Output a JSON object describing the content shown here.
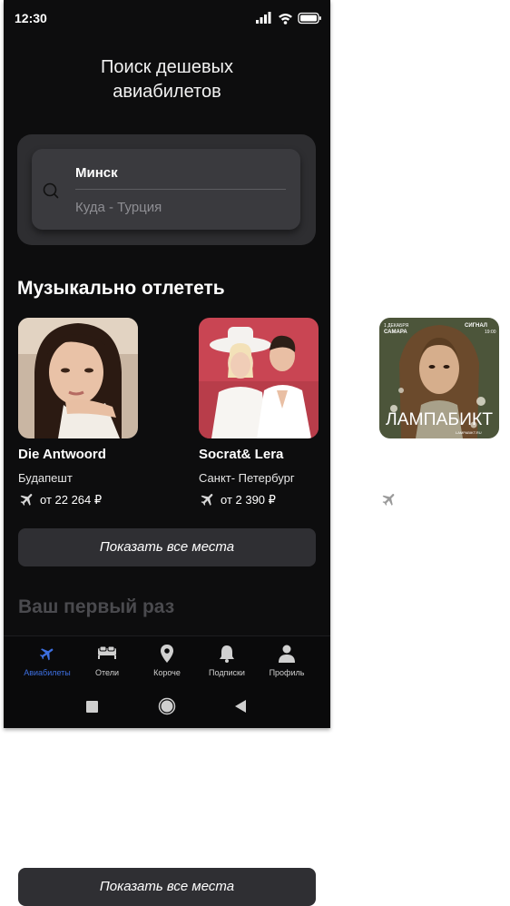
{
  "status_bar": {
    "time": "12:30"
  },
  "header": {
    "title": "Поиск дешевых\nавиабилетов"
  },
  "search": {
    "from": "Минск",
    "to_placeholder": "Куда - Турция"
  },
  "music_section": {
    "title": "Музыкально отлететь",
    "cards": [
      {
        "name": "Die Antwoord",
        "city": "Будапешт",
        "price": "от 22 264 ₽"
      },
      {
        "name": "Socrat& Lera",
        "city": "Санкт- Петербург",
        "price": "от 2 390 ₽"
      }
    ],
    "poster": {
      "date": "1 ДЕКАБРЯ",
      "city": "САМАРА",
      "venue": "СИГНАЛ",
      "time": "19:00",
      "title": "ЛАМПАБИКТ",
      "site": "LAMPABIKT.RU"
    }
  },
  "show_all_label": "Показать все места",
  "first_time_section": {
    "title": "Ваш первый раз"
  },
  "tab_bar": {
    "active_color": "#3d6fe0",
    "items": [
      {
        "label": "Авиабилеты",
        "icon": "airplane-icon",
        "active": true
      },
      {
        "label": "Отели",
        "icon": "bed-icon",
        "active": false
      },
      {
        "label": "Короче",
        "icon": "map-pin-icon",
        "active": false
      },
      {
        "label": "Подписки",
        "icon": "bell-icon",
        "active": false
      },
      {
        "label": "Профиль",
        "icon": "user-icon",
        "active": false
      }
    ]
  },
  "android_nav": {
    "buttons": [
      "recents-icon",
      "home-icon",
      "back-icon"
    ]
  }
}
